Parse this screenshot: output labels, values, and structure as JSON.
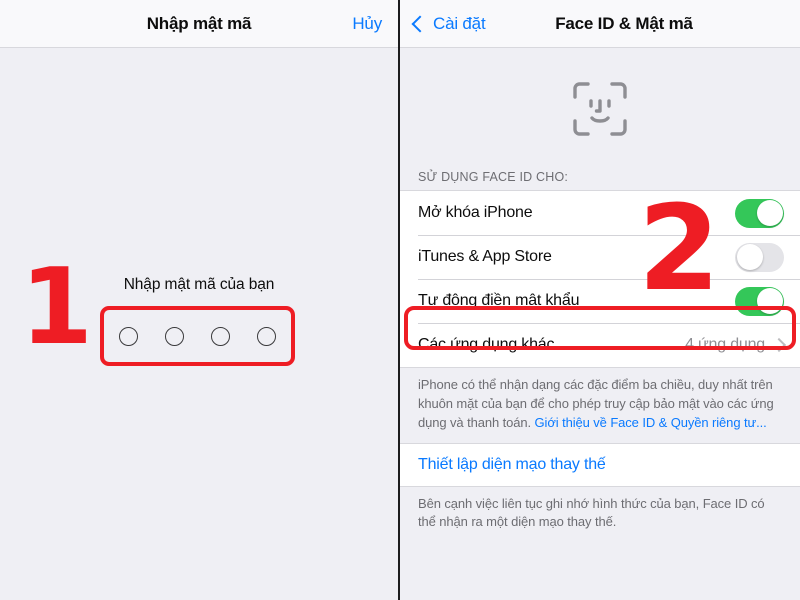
{
  "left_panel": {
    "navbar": {
      "title": "Nhập mật mã",
      "cancel_label": "Hủy"
    },
    "prompt": "Nhập mật mã của bạn",
    "passcode_dots": 4,
    "step_number": "1"
  },
  "right_panel": {
    "navbar": {
      "back_label": "Cài đặt",
      "title": "Face ID & Mật mã"
    },
    "faceid_icon": "face-id-icon",
    "section_label": "SỬ DỤNG FACE ID CHO:",
    "step_number": "2",
    "rows": [
      {
        "label": "Mở khóa iPhone",
        "control": "toggle",
        "state": "on"
      },
      {
        "label": "iTunes & App Store",
        "control": "toggle",
        "state": "off"
      },
      {
        "label": "Tự động điền mật khẩu",
        "control": "toggle",
        "state": "on"
      },
      {
        "label": "Các ứng dụng khác",
        "control": "disclosure",
        "value": "4 ứng dụng"
      }
    ],
    "footnote": {
      "text": "iPhone có thể nhận dạng các đặc điểm ba chiều, duy nhất trên khuôn mặt của bạn để cho phép truy cập bảo mật vào các ứng dụng và thanh toán. ",
      "link": "Giới thiệu về Face ID & Quyền riêng tư..."
    },
    "alt_appearance": "Thiết lập diện mạo thay thế",
    "footnote_bottom": "Bên cạnh việc liên tục ghi nhớ hình thức của bạn, Face ID có thể nhận ra một diện mạo thay thế."
  },
  "colors": {
    "accent_blue": "#0A7AFF",
    "toggle_on_green": "#34C759",
    "annotation_red": "#EE1D24",
    "background_gray": "#EFEFF4"
  }
}
